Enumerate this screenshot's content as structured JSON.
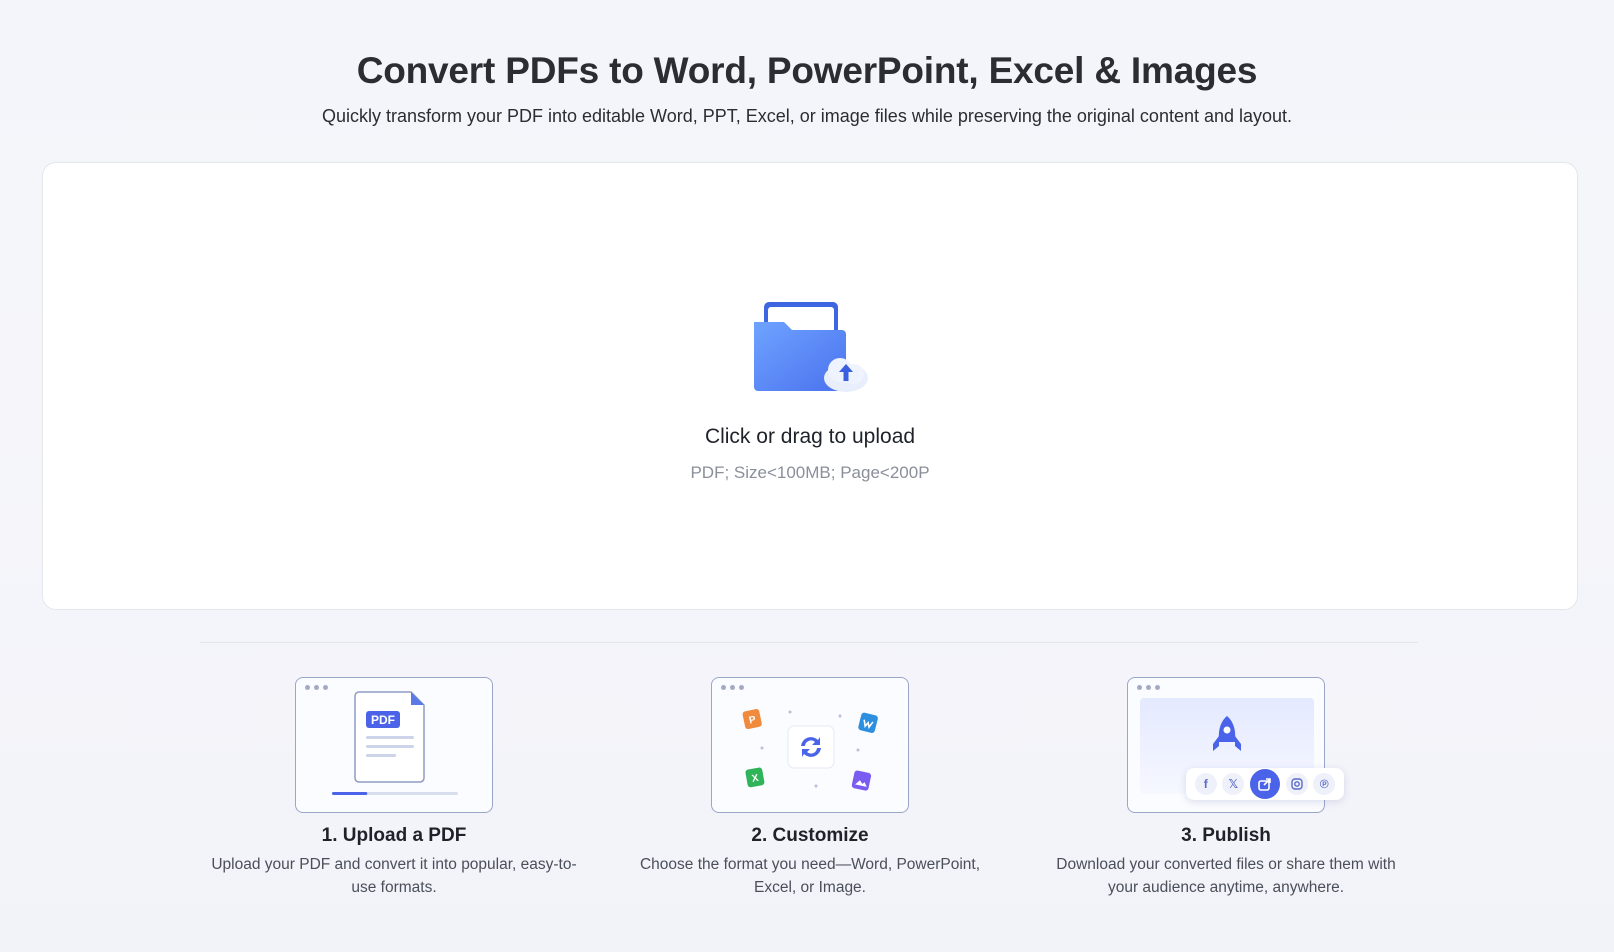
{
  "header": {
    "title": "Convert PDFs to Word, PowerPoint, Excel & Images",
    "subtitle": "Quickly transform your PDF into editable Word, PPT, Excel, or image files while preserving the original content and layout."
  },
  "upload": {
    "icon": "folder-upload-icon",
    "label": "Click or drag to upload",
    "hint": "PDF; Size<100MB; Page<200P"
  },
  "steps": [
    {
      "title": "1. Upload a PDF",
      "description": "Upload your PDF and convert it into popular, easy-to-use formats.",
      "badge": "PDF",
      "progress": 0.28
    },
    {
      "title": "2. Customize",
      "description": "Choose the format you need—Word, PowerPoint, Excel, or Image.",
      "format_icons": [
        "powerpoint-icon",
        "word-icon",
        "excel-icon",
        "image-icon",
        "convert-icon"
      ]
    },
    {
      "title": "3. Publish",
      "description": "Download your converted files or share them with your audience anytime, anywhere.",
      "share_icons": [
        "facebook-icon",
        "x-icon",
        "share-icon",
        "instagram-icon",
        "pinterest-icon"
      ]
    }
  ],
  "colors": {
    "accent": "#4a63e8",
    "folder": "#5b8def",
    "powerpoint": "#f08a3c",
    "word": "#2d8fe0",
    "excel": "#2fb45a",
    "image": "#7a5cf0"
  }
}
